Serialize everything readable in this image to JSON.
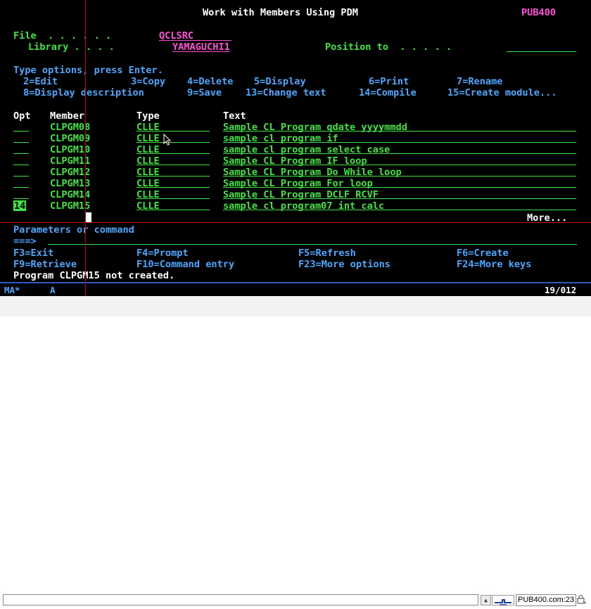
{
  "screen": {
    "title": "Work with Members Using PDM",
    "system": "PUB400",
    "file_label": "File  . . . . . .",
    "file_value": "QCLSRC",
    "library_label": "Library . . . .",
    "library_value": "YAMAGUCHI1",
    "position_to_label": "Position to  . . . . .",
    "position_to_value": "",
    "instructions": "Type options, press Enter.",
    "options": [
      {
        "text": "2=Edit"
      },
      {
        "text": "3=Copy"
      },
      {
        "text": "4=Delete"
      },
      {
        "text": "5=Display"
      },
      {
        "text": "6=Print"
      },
      {
        "text": "7=Rename"
      },
      {
        "text": "8=Display description"
      },
      {
        "text": "9=Save"
      },
      {
        "text": "13=Change text"
      },
      {
        "text": "14=Compile"
      },
      {
        "text": "15=Create module..."
      }
    ],
    "columns": {
      "opt": "Opt",
      "member": "Member",
      "type": "Type",
      "text": "Text"
    },
    "rows": [
      {
        "opt": "",
        "member": "CLPGM08",
        "type": "CLLE",
        "text": "Sample CL Program qdate yyyymmdd"
      },
      {
        "opt": "",
        "member": "CLPGM09",
        "type": "CLLE",
        "text": "sample cl program if"
      },
      {
        "opt": "",
        "member": "CLPGM10",
        "type": "CLLE",
        "text": "sample cl program select case"
      },
      {
        "opt": "",
        "member": "CLPGM11",
        "type": "CLLE",
        "text": "Sample CL Program IF loop"
      },
      {
        "opt": "",
        "member": "CLPGM12",
        "type": "CLLE",
        "text": "Sample CL Program Do While loop"
      },
      {
        "opt": "",
        "member": "CLPGM13",
        "type": "CLLE",
        "text": "Sample CL Program For loop"
      },
      {
        "opt": "",
        "member": "CLPGM14",
        "type": "CLLE",
        "text": "Sample CL Program DCLF RCVF"
      },
      {
        "opt": "14",
        "member": "CLPGM15",
        "type": "CLLE",
        "text": "sample cl program07 int calc"
      }
    ],
    "more": "More...",
    "params_label": "Parameters or command",
    "prompt": "===>",
    "command_value": "",
    "fkeys": [
      {
        "text": "F3=Exit"
      },
      {
        "text": "F4=Prompt"
      },
      {
        "text": "F5=Refresh"
      },
      {
        "text": "F6=Create"
      },
      {
        "text": "F9=Retrieve"
      },
      {
        "text": "F10=Command entry"
      },
      {
        "text": "F23=More options"
      },
      {
        "text": "F24=More keys"
      }
    ],
    "message": "Program CLPGM15 not created."
  },
  "status": {
    "indicator": "MA*",
    "mode": "A",
    "cursor_pos": "19/012"
  },
  "bottombar": {
    "session": "PUB400.com:23"
  },
  "colors": {
    "green": "#3ee63e",
    "blue": "#4aa8ff",
    "pink": "#ff4fd8",
    "white": "#ffffff",
    "background": "#000000"
  }
}
